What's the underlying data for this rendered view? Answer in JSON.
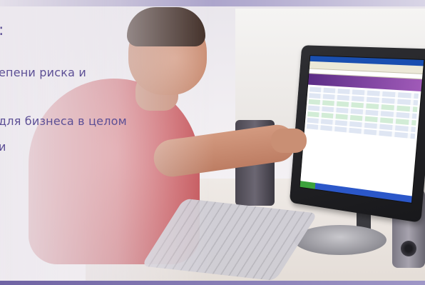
{
  "slide": {
    "heading_fragment": ":",
    "lines": [
      "епени риска и",
      "для бизнеса в целом",
      "и"
    ]
  },
  "colors": {
    "text": "#5c4f95",
    "top_band": "#8b82b6",
    "bottom_band": "#6f63a3"
  }
}
